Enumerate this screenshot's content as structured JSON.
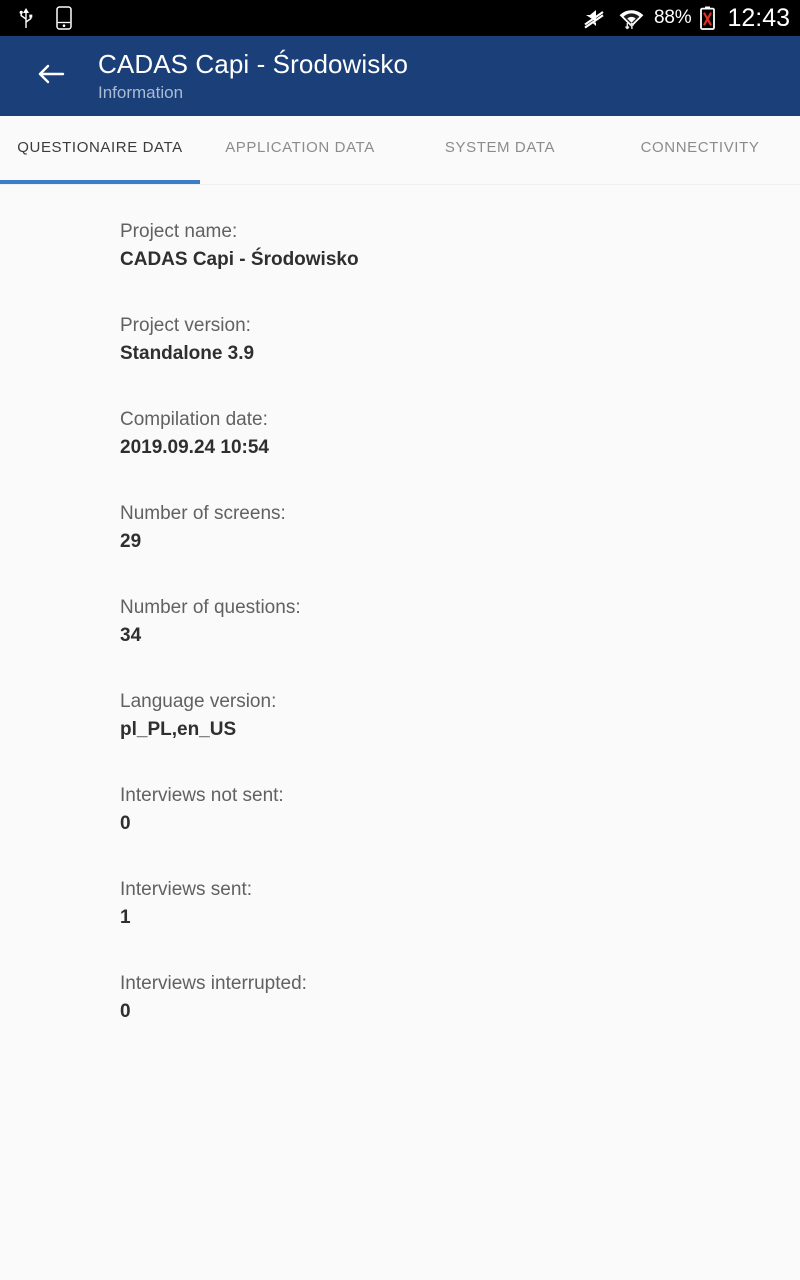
{
  "statusbar": {
    "left_icons": [
      "usb-icon",
      "sim-card-icon"
    ],
    "right_icons": [
      "mute-icon",
      "wifi-data-icon",
      "battery-error-icon"
    ],
    "battery_percent": "88%",
    "clock": "12:43"
  },
  "appbar": {
    "back_icon": "back-arrow-icon",
    "title": "CADAS Capi - Środowisko",
    "subtitle": "Information",
    "background_color": "#1b4079"
  },
  "tabs": {
    "active_index": 0,
    "accent_color": "#3d7cc9",
    "items": [
      {
        "label": "QUESTIONAIRE DATA"
      },
      {
        "label": "APPLICATION DATA"
      },
      {
        "label": "SYSTEM DATA"
      },
      {
        "label": "CONNECTIVITY"
      }
    ]
  },
  "content": {
    "fields": [
      {
        "label": "Project name:",
        "value": "CADAS Capi - Środowisko"
      },
      {
        "label": "Project version:",
        "value": "Standalone 3.9"
      },
      {
        "label": "Compilation date:",
        "value": "2019.09.24 10:54"
      },
      {
        "label": "Number of screens:",
        "value": "29"
      },
      {
        "label": "Number of questions:",
        "value": "34"
      },
      {
        "label": "Language version:",
        "value": "pl_PL,en_US"
      },
      {
        "label": "Interviews not sent:",
        "value": "0"
      },
      {
        "label": "Interviews sent:",
        "value": "1"
      },
      {
        "label": "Interviews interrupted:",
        "value": "0"
      }
    ]
  }
}
